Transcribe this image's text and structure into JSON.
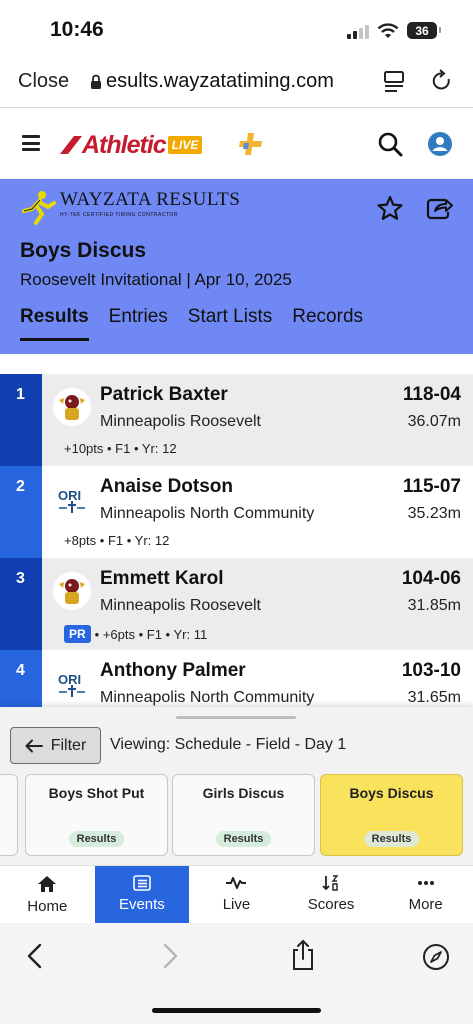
{
  "status_bar": {
    "time": "10:46",
    "battery": "36"
  },
  "browser": {
    "close_label": "Close",
    "url": "esults.wayzatatiming.com"
  },
  "app": {
    "logo_text": "Athletic",
    "logo_badge": "LIVE"
  },
  "event_header": {
    "brand_name": "WAYZATA RESULTS",
    "brand_sub": "HY-TEK CERTIFIED TIMING CONTRACTOR",
    "title": "Boys Discus",
    "subtitle": "Roosevelt Invitational | Apr 10, 2025",
    "tabs": [
      {
        "label": "Results",
        "active": true
      },
      {
        "label": "Entries",
        "active": false
      },
      {
        "label": "Start Lists",
        "active": false
      },
      {
        "label": "Records",
        "active": false
      }
    ]
  },
  "results": [
    {
      "place": "1",
      "name": "Patrick Baxter",
      "team": "Minneapolis Roosevelt",
      "mark": "118-04",
      "metric": "36.07m",
      "meta": "+10pts • F1 • Yr: 12",
      "pr": ""
    },
    {
      "place": "2",
      "name": "Anaise Dotson",
      "team": "Minneapolis North Community",
      "mark": "115-07",
      "metric": "35.23m",
      "meta": "+8pts • F1 • Yr: 12",
      "pr": ""
    },
    {
      "place": "3",
      "name": "Emmett Karol",
      "team": "Minneapolis Roosevelt",
      "mark": "104-06",
      "metric": "31.85m",
      "meta": "• +6pts • F1 • Yr: 11",
      "pr": "PR"
    },
    {
      "place": "4",
      "name": "Anthony Palmer",
      "team": "Minneapolis North Community",
      "mark": "103-10",
      "metric": "31.65m",
      "meta": "",
      "pr": ""
    }
  ],
  "sheet": {
    "filter_label": "Filter",
    "viewing_text": "Viewing: Schedule - Field - Day 1",
    "cards": [
      {
        "title": "Boys Shot Put",
        "pill": "Results",
        "selected": false
      },
      {
        "title": "Girls Discus",
        "pill": "Results",
        "selected": false
      },
      {
        "title": "Boys Discus",
        "pill": "Results",
        "selected": true
      }
    ]
  },
  "bottom_nav": [
    {
      "label": "Home",
      "icon": "home-icon",
      "active": false
    },
    {
      "label": "Events",
      "icon": "list-icon",
      "active": true
    },
    {
      "label": "Live",
      "icon": "pulse-icon",
      "active": false
    },
    {
      "label": "Scores",
      "icon": "sort-icon",
      "active": false
    },
    {
      "label": "More",
      "icon": "more-icon",
      "active": false
    }
  ],
  "colors": {
    "header_bg": "#6f88f4",
    "accent": "#2866e0",
    "place_dark": "#0f3fb0",
    "selected_card": "#f9e35c"
  }
}
